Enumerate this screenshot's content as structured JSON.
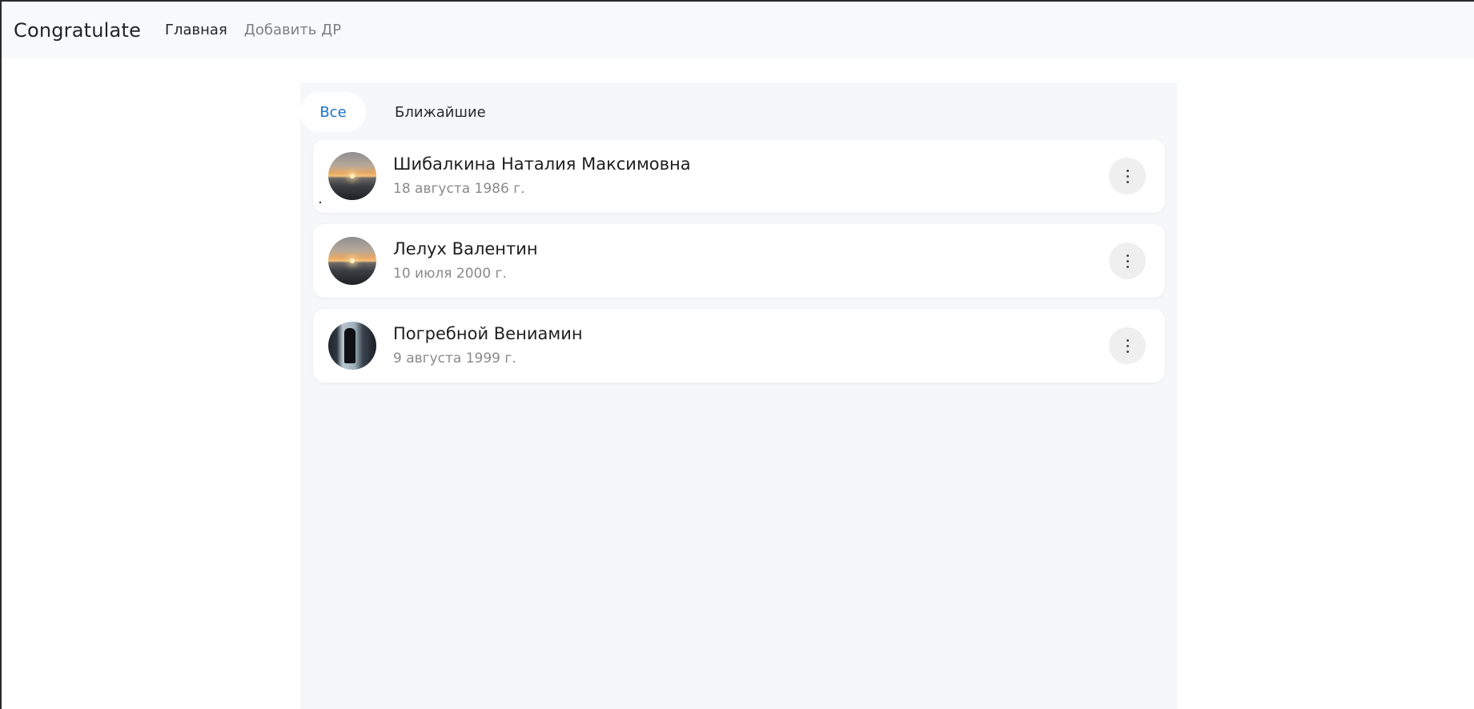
{
  "navbar": {
    "brand": "Congratulate",
    "links": [
      {
        "label": "Главная",
        "active": true
      },
      {
        "label": "Добавить ДР",
        "active": false
      }
    ]
  },
  "tabs": [
    {
      "label": "Все",
      "active": true
    },
    {
      "label": "Ближайшие",
      "active": false
    }
  ],
  "birthdays": [
    {
      "name": "Шибалкина Наталия Максимовна",
      "date": "18 августа 1986 г.",
      "avatar": "sunset-photo"
    },
    {
      "name": "Лелух Валентин",
      "date": "10 июля 2000 г.",
      "avatar": "sunset-photo"
    },
    {
      "name": "Погребной Вениамин",
      "date": "9 августа 1999 г.",
      "avatar": "window-silhouette-photo"
    }
  ],
  "colors": {
    "accent": "#1a73c8",
    "navbar_bg": "#f8f9fa",
    "panel_bg": "#f6f7f9"
  },
  "icons": {
    "card_menu": "more-vertical-icon"
  }
}
